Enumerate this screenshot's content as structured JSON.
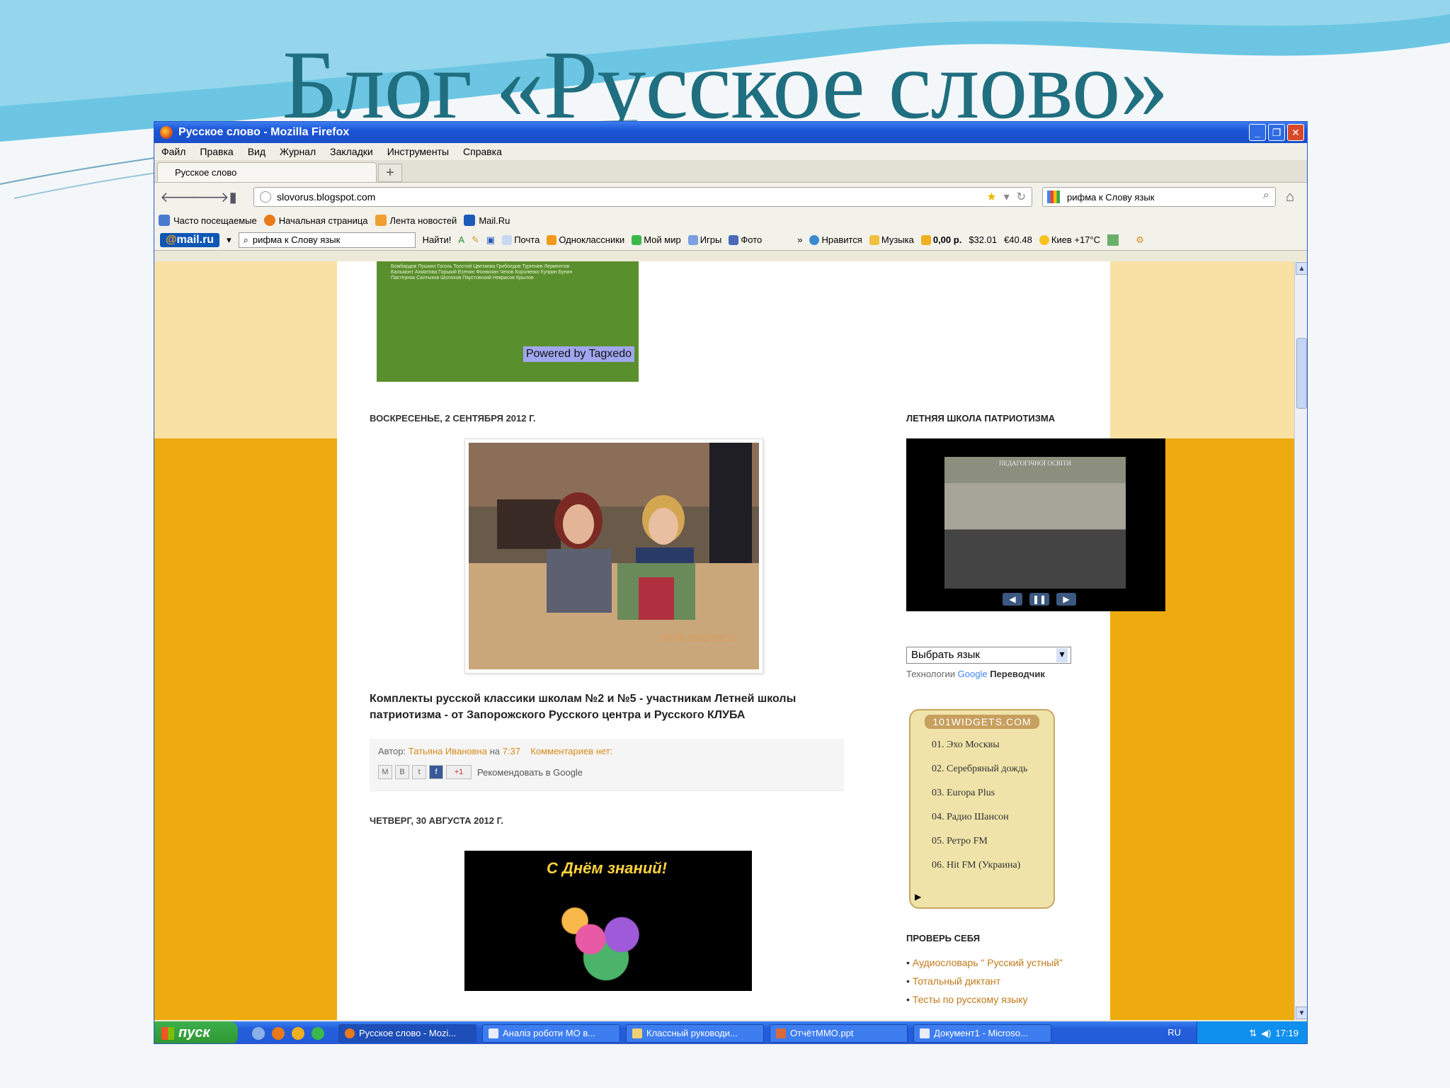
{
  "slide": {
    "title": "Блог «Русское слово»"
  },
  "window": {
    "title": "Русское слово - Mozilla Firefox",
    "menu": [
      "Файл",
      "Правка",
      "Вид",
      "Журнал",
      "Закладки",
      "Инструменты",
      "Справка"
    ],
    "tab_label": "Русское слово",
    "url": "slovorus.blogspot.com",
    "search_value": "рифма  к Слову язык",
    "bookmarks": [
      {
        "label": "Часто посещаемые",
        "color": "#4a7ad0"
      },
      {
        "label": "Начальная страница",
        "color": "#e87a1a"
      },
      {
        "label": "Лента новостей",
        "color": "#f0a030"
      },
      {
        "label": "Mail.Ru",
        "color": "#1a5ab8"
      }
    ],
    "mailbar": {
      "logo": "@mail.ru",
      "search_value": "рифма  к Слову язык",
      "find_label": "Найти!",
      "items": [
        "Почта",
        "Одноклассники",
        "Мой мир",
        "Игры",
        "Фото"
      ],
      "more": "»",
      "right_items": [
        "Нравится",
        "Музыка",
        "0,00 р.",
        "$32.01",
        "€40.48",
        "Киев +17°C"
      ]
    }
  },
  "blog": {
    "cloud_powered": "Powered by Tagxedo",
    "cloud_words": "Бомбардов Пушкин Гоголь Толстой Цветаева Грибоедов Тургенев Лермонтов Бальмонт Ахматова Горький Есенин Фонвизин Чехов Короленко Куприн Бунин Пастернак Салтыков Шолохов Паустовский Некрасов Крылов",
    "post1": {
      "date": "ВОСКРЕСЕНЬЕ, 2 СЕНТЯБРЯ 2012 Г.",
      "photo_stamp": "29.08.2012 09:11",
      "title": "Комплекты русской классики школам №2 и №5 - участникам Летней школы патриотизма - от Запорожского Русского центра и Русского КЛУБА",
      "author_prefix": "Автор:",
      "author": "Татьяна Ивановна",
      "at": "на",
      "time": "7:37",
      "comments": "Комментариев нет:",
      "plusone": "+1",
      "recommend": "Рекомендовать в Google"
    },
    "post2": {
      "date": "ЧЕТВЕРГ, 30 АВГУСТА 2012 Г.",
      "headline": "С Днём знаний!"
    },
    "sidebar": {
      "school_title": "ЛЕТНЯЯ ШКОЛА ПАТРИОТИЗМА",
      "photo_banner": "ПЕДАГОГІЧНОЇ ОСВІТИ",
      "lang_select": "Выбрать язык",
      "translator_prefix": "Технологии",
      "translator_brand": "Google",
      "translator_suffix": "Переводчик",
      "radio_header": "101WIDGETS.COM",
      "stations": [
        "01. Эхо Москвы",
        "02. Серебряный дождь",
        "03. Europa Plus",
        "04. Радио Шансон",
        "05. Ретро FM",
        "06. Hit FM (Украина)"
      ],
      "check_title": "ПРОВЕРЬ СЕБЯ",
      "check_links": [
        "Аудиословарь \" Русский устный\"",
        "Тотальный диктант",
        "Тесты по русскому языку"
      ]
    }
  },
  "taskbar": {
    "start": "пуск",
    "tasks": [
      "Русское слово - Mozi...",
      "Аналіз роботи МО в...",
      "Классный руководи...",
      "ОтчётММО.ppt",
      "Документ1 - Microso..."
    ],
    "lang": "RU",
    "clock": "17:19"
  },
  "colors": {
    "title": "#1f6f80",
    "page_bg_top": "#f9e1a4",
    "page_bg_bottom": "#eeab10",
    "link": "#c07a1a"
  }
}
